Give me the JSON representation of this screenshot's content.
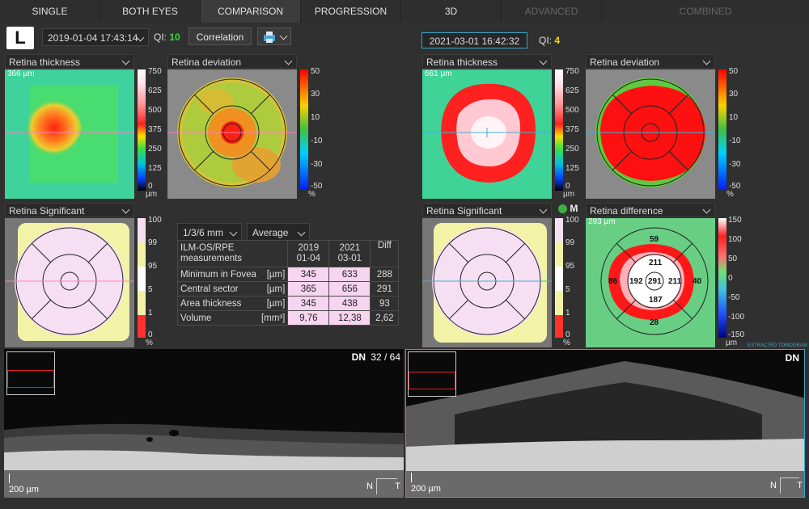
{
  "tabs": [
    {
      "label": "SINGLE",
      "state": "normal"
    },
    {
      "label": "BOTH EYES",
      "state": "normal"
    },
    {
      "label": "COMPARISON",
      "state": "active"
    },
    {
      "label": "PROGRESSION",
      "state": "normal"
    },
    {
      "label": "3D",
      "state": "normal"
    },
    {
      "label": "ADVANCED",
      "state": "disabled"
    },
    {
      "label": "COMBINED",
      "state": "disabled"
    }
  ],
  "eye": "L",
  "left_exam": {
    "date": "2019-01-04 17:43:14",
    "qi_label": "QI:",
    "qi_value": "10",
    "qi_color": "#3fd33f"
  },
  "correlation_label": "Correlation",
  "right_exam": {
    "date": "2021-03-01 16:42:32",
    "qi_label": "QI:",
    "qi_value": "4",
    "qi_color": "#ffd400"
  },
  "left_maps": {
    "thickness": {
      "title": "Retina thickness",
      "value": "366 µm"
    },
    "deviation": {
      "title": "Retina deviation"
    },
    "significant": {
      "title": "Retina Significant"
    }
  },
  "right_maps": {
    "thickness": {
      "title": "Retina thickness",
      "value": "661 µm"
    },
    "deviation": {
      "title": "Retina deviation"
    },
    "significant": {
      "title": "Retina Significant"
    },
    "difference": {
      "title": "Retina difference",
      "value": "293 µm"
    }
  },
  "thickness_scale": {
    "ticks": [
      "750",
      "625",
      "500",
      "375",
      "250",
      "125",
      "0"
    ],
    "unit": "µm"
  },
  "deviation_scale": {
    "ticks": [
      "50",
      "30",
      "10",
      "-10",
      "-30",
      "-50"
    ],
    "unit": "%"
  },
  "significant_scale": {
    "ticks": [
      "100",
      "99",
      "95",
      "5",
      "1",
      "0"
    ],
    "unit": "%"
  },
  "difference_scale": {
    "ticks": [
      "150",
      "100",
      "50",
      "0",
      "-50",
      "-100",
      "-150"
    ],
    "unit": "µm"
  },
  "grid_select": "1/3/6 mm",
  "mode_select": "Average",
  "measurements": {
    "header": {
      "label": "ILM-OS/RPE measurements",
      "col1": "2019 01-04",
      "col2": "2021 03-01",
      "diff": "Diff"
    },
    "rows": [
      {
        "name": "Minimum in Fovea",
        "unit": "[µm]",
        "v1": "345",
        "v2": "633",
        "diff": "288"
      },
      {
        "name": "Central sector",
        "unit": "[µm]",
        "v1": "365",
        "v2": "656",
        "diff": "291"
      },
      {
        "name": "Area thickness",
        "unit": "[µm]",
        "v1": "345",
        "v2": "438",
        "diff": "93"
      },
      {
        "name": "Volume",
        "unit": "[mm³]",
        "v1": "9,76",
        "v2": "12,38",
        "diff": "2,62"
      }
    ]
  },
  "difference_sectors": {
    "superior_outer": "59",
    "superior_inner": "211",
    "nasal_outer": "86",
    "nasal_inner": "192",
    "center": "291",
    "temporal_inner": "211",
    "temporal_outer": "40",
    "inferior_inner": "187",
    "inferior_outer": "28"
  },
  "significant_badge": "M",
  "tomogram_left": {
    "direction": "DN",
    "slice": "32 / 64",
    "scale": "200 µm",
    "orient_n": "N",
    "orient_t": "T"
  },
  "tomogram_right": {
    "direction": "DN",
    "scale": "200 µm",
    "orient_n": "N",
    "orient_t": "T",
    "badge": "EXTRACTED TOMOGRAM"
  }
}
